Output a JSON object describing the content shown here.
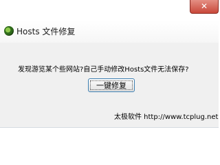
{
  "window": {
    "title": "Hosts 文件修复",
    "close_label": "✕",
    "app_icon": "globe-app-icon"
  },
  "main": {
    "question": "发现游览某个些网站?自己手动修改Hosts文件无法保存?",
    "fix_button_label": "一键修复"
  },
  "footer": {
    "credit": "太极软件 http://www.tcplug.net"
  }
}
